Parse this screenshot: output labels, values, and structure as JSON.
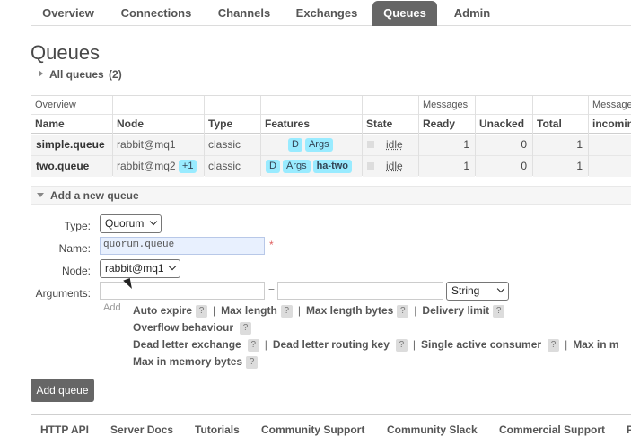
{
  "nav": {
    "tabs": [
      {
        "label": "Overview"
      },
      {
        "label": "Connections"
      },
      {
        "label": "Channels"
      },
      {
        "label": "Exchanges"
      },
      {
        "label": "Queues",
        "active": true
      },
      {
        "label": "Admin"
      }
    ]
  },
  "page": {
    "title": "Queues",
    "all_queues_label": "All queues",
    "all_queues_count": "(2)"
  },
  "table": {
    "group_headers": {
      "overview": "Overview",
      "messages": "Messages",
      "message_rates": "Message"
    },
    "columns": {
      "name": "Name",
      "node": "Node",
      "type": "Type",
      "features": "Features",
      "state": "State",
      "ready": "Ready",
      "unacked": "Unacked",
      "total": "Total",
      "incoming": "incomin"
    },
    "rows": [
      {
        "name": "simple.queue",
        "node": "rabbit@mq1",
        "node_extra": "",
        "type": "classic",
        "features": [
          "D",
          "Args"
        ],
        "policy": "",
        "state": "idle",
        "ready": "1",
        "unacked": "0",
        "total": "1"
      },
      {
        "name": "two.queue",
        "node": "rabbit@mq2",
        "node_extra": "+1",
        "type": "classic",
        "features": [
          "D",
          "Args"
        ],
        "policy": "ha-two",
        "state": "idle",
        "ready": "1",
        "unacked": "0",
        "total": "1"
      }
    ]
  },
  "add_queue": {
    "section_title": "Add a new queue",
    "type_label": "Type:",
    "type_value": "Quorum",
    "name_label": "Name:",
    "name_value": "quorum.queue",
    "required_mark": "*",
    "node_label": "Node:",
    "node_value": "rabbit@mq1",
    "arguments_label": "Arguments:",
    "equals": "=",
    "arg_type_value": "String",
    "add_link": "Add",
    "help_mark": "?",
    "separator": "|",
    "arg_options": {
      "auto_expire": "Auto expire",
      "max_length": "Max length",
      "max_length_bytes": "Max length bytes",
      "delivery_limit": "Delivery limit",
      "overflow_behaviour": "Overflow behaviour",
      "dead_letter_exchange": "Dead letter exchange",
      "dead_letter_routing_key": "Dead letter routing key",
      "single_active_consumer": "Single active consumer",
      "max_in_memory_length": "Max in m",
      "max_in_memory_bytes": "Max in memory bytes"
    },
    "submit_label": "Add queue"
  },
  "footer": {
    "links": [
      "HTTP API",
      "Server Docs",
      "Tutorials",
      "Community Support",
      "Community Slack",
      "Commercial Support",
      "P"
    ]
  },
  "colors": {
    "tab_active": "#666666",
    "badge": "#99ebff",
    "button": "#666666"
  }
}
